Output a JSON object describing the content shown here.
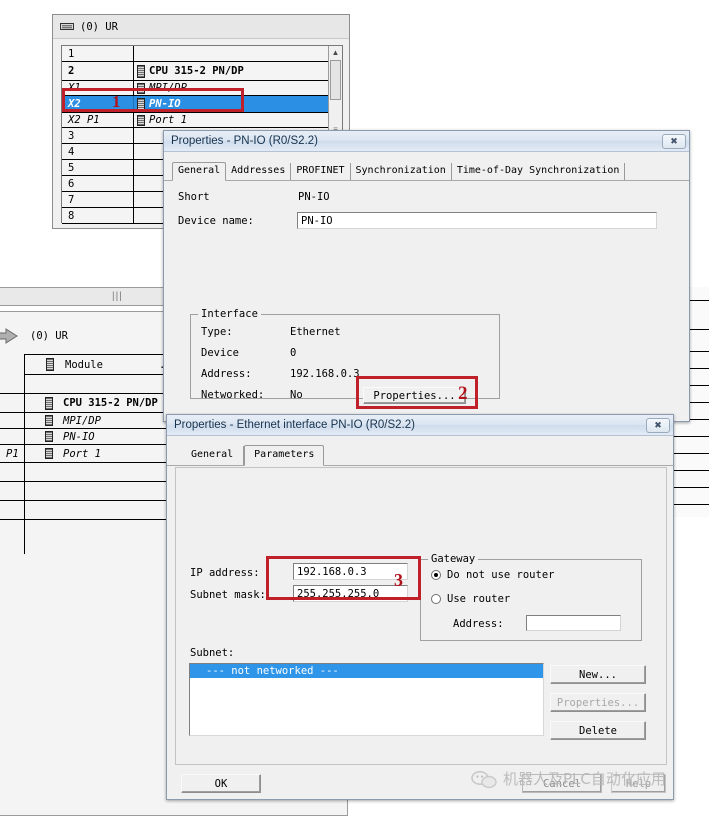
{
  "app": {
    "watermark": "机器人及PLC自动化应用"
  },
  "rack_window": {
    "title": "(0) UR",
    "icon": "rack-icon",
    "rows": [
      {
        "slot": "1",
        "module": "",
        "chip": false,
        "style": "plain",
        "selected": false
      },
      {
        "slot": "2",
        "module": "CPU 315-2 PN/DP",
        "chip": true,
        "style": "bold",
        "selected": false
      },
      {
        "slot": "X1",
        "module": "MPI/DP",
        "chip": true,
        "style": "italic",
        "selected": false
      },
      {
        "slot": "X2",
        "module": "PN-IO",
        "chip": true,
        "style": "bold-italic",
        "selected": true
      },
      {
        "slot": "X2 P1",
        "module": "Port 1",
        "chip": true,
        "style": "italic",
        "selected": false
      },
      {
        "slot": "3",
        "module": "",
        "chip": false,
        "style": "plain",
        "selected": false
      },
      {
        "slot": "4",
        "module": "",
        "chip": false,
        "style": "plain",
        "selected": false
      },
      {
        "slot": "5",
        "module": "",
        "chip": false,
        "style": "plain",
        "selected": false
      },
      {
        "slot": "6",
        "module": "",
        "chip": false,
        "style": "plain",
        "selected": false
      },
      {
        "slot": "7",
        "module": "",
        "chip": false,
        "style": "plain",
        "selected": false
      },
      {
        "slot": "8",
        "module": "",
        "chip": false,
        "style": "plain",
        "selected": false
      }
    ]
  },
  "background_rack": {
    "title": "(0)   UR",
    "header": {
      "module": "Module",
      "dots": "..."
    },
    "rows": [
      {
        "slot": "",
        "module": "CPU 315-2 PN/DP",
        "style": "bold"
      },
      {
        "slot": "",
        "module": "MPI/DP",
        "style": "italic"
      },
      {
        "slot": "",
        "module": "PN-IO",
        "style": "italic"
      },
      {
        "slot": "P1",
        "module": "Port 1",
        "style": "italic"
      }
    ]
  },
  "pnio_dialog": {
    "title": "Properties - PN-IO (R0/S2.2)",
    "close_label": "✖",
    "tabs": [
      {
        "label": "General",
        "active": true
      },
      {
        "label": "Addresses",
        "active": false
      },
      {
        "label": "PROFINET",
        "active": false
      },
      {
        "label": "Synchronization",
        "active": false
      },
      {
        "label": "Time-of-Day Synchronization",
        "active": false
      }
    ],
    "short_label": "Short",
    "short_value": "PN-IO",
    "device_name_label": "Device name:",
    "device_name_value": "PN-IO",
    "interface_group": "Interface",
    "rows": [
      {
        "label": "Type:",
        "value": "Ethernet"
      },
      {
        "label": "Device",
        "value": "0"
      },
      {
        "label": "Address:",
        "value": "192.168.0.3"
      },
      {
        "label": "Networked:",
        "value": "No"
      }
    ],
    "properties_button": "Properties..."
  },
  "ethernet_dialog": {
    "title": "Properties - Ethernet interface  PN-IO (R0/S2.2)",
    "close_label": "✖",
    "tabs": [
      {
        "label": "General",
        "active": false
      },
      {
        "label": "Parameters",
        "active": true
      }
    ],
    "ip_label": "IP address:",
    "ip_value": "192.168.0.3",
    "mask_label": "Subnet mask:",
    "mask_value": "255.255.255.0",
    "gateway_group": "Gateway",
    "gateway_options": [
      {
        "label": "Do not use router",
        "checked": true
      },
      {
        "label": "Use router",
        "checked": false
      }
    ],
    "gateway_address_label": "Address:",
    "gateway_address_value": "",
    "subnet_label": "Subnet:",
    "subnet_items": [
      {
        "label": "--- not networked ---",
        "selected": true
      }
    ],
    "side_buttons": [
      {
        "label": "New...",
        "disabled": false
      },
      {
        "label": "Properties...",
        "disabled": true
      },
      {
        "label": "Delete",
        "disabled": false
      }
    ],
    "ok_button": "OK",
    "cancel_button": "Cancel",
    "help_button": "Help"
  },
  "annotations": [
    {
      "number": "1",
      "target": "rack-row-pnio"
    },
    {
      "number": "2",
      "target": "pnio-properties-button"
    },
    {
      "number": "3",
      "target": "ip-fields"
    }
  ],
  "colors": {
    "selection_blue": "#2b8fe4",
    "annotation_red": "#c0202a",
    "dialog_face": "#f0f0f0",
    "title_text": "#17334f"
  }
}
